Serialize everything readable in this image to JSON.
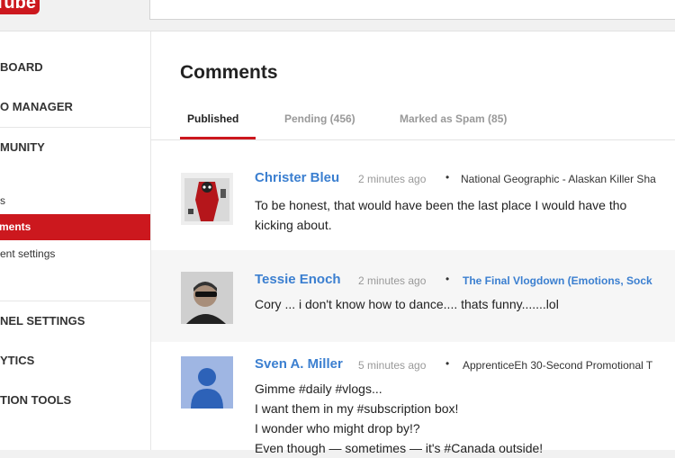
{
  "logo": {
    "text": "Tube"
  },
  "sidebar": {
    "items": [
      {
        "label": "BOARD"
      },
      {
        "label": "O MANAGER"
      },
      {
        "label": "MUNITY"
      },
      {
        "label": "s"
      },
      {
        "label": "ments"
      },
      {
        "label": "ent settings"
      },
      {
        "label": "NEL SETTINGS"
      },
      {
        "label": "YTICS"
      },
      {
        "label": "TION TOOLS"
      }
    ]
  },
  "page": {
    "title": "Comments"
  },
  "tabs": [
    {
      "label": "Published"
    },
    {
      "label": "Pending (456)"
    },
    {
      "label": "Marked as Spam (85)"
    }
  ],
  "comments": [
    {
      "author": "Christer Bleu",
      "time": "2 minutes ago",
      "video": "National Geographic - Alaskan Killer Sha",
      "lines": [
        "To be honest, that would have been the last place I would have tho",
        "kicking about."
      ]
    },
    {
      "author": "Tessie Enoch",
      "time": "2 minutes ago",
      "video": "The Final Vlogdown (Emotions, Sock",
      "lines": [
        "Cory ... i don't know how to dance.... thats funny.......lol"
      ]
    },
    {
      "author": "Sven A. Miller",
      "time": "5 minutes ago",
      "video": "ApprenticeEh 30-Second Promotional T",
      "lines": [
        "Gimme #daily #vlogs...",
        "I want them in my #subscription box!",
        "I wonder who might drop by!?",
        "Even though — sometimes — it's #Canada outside!"
      ]
    }
  ],
  "colors": {
    "accent": "#cc181e",
    "link": "#3b7fd0"
  }
}
